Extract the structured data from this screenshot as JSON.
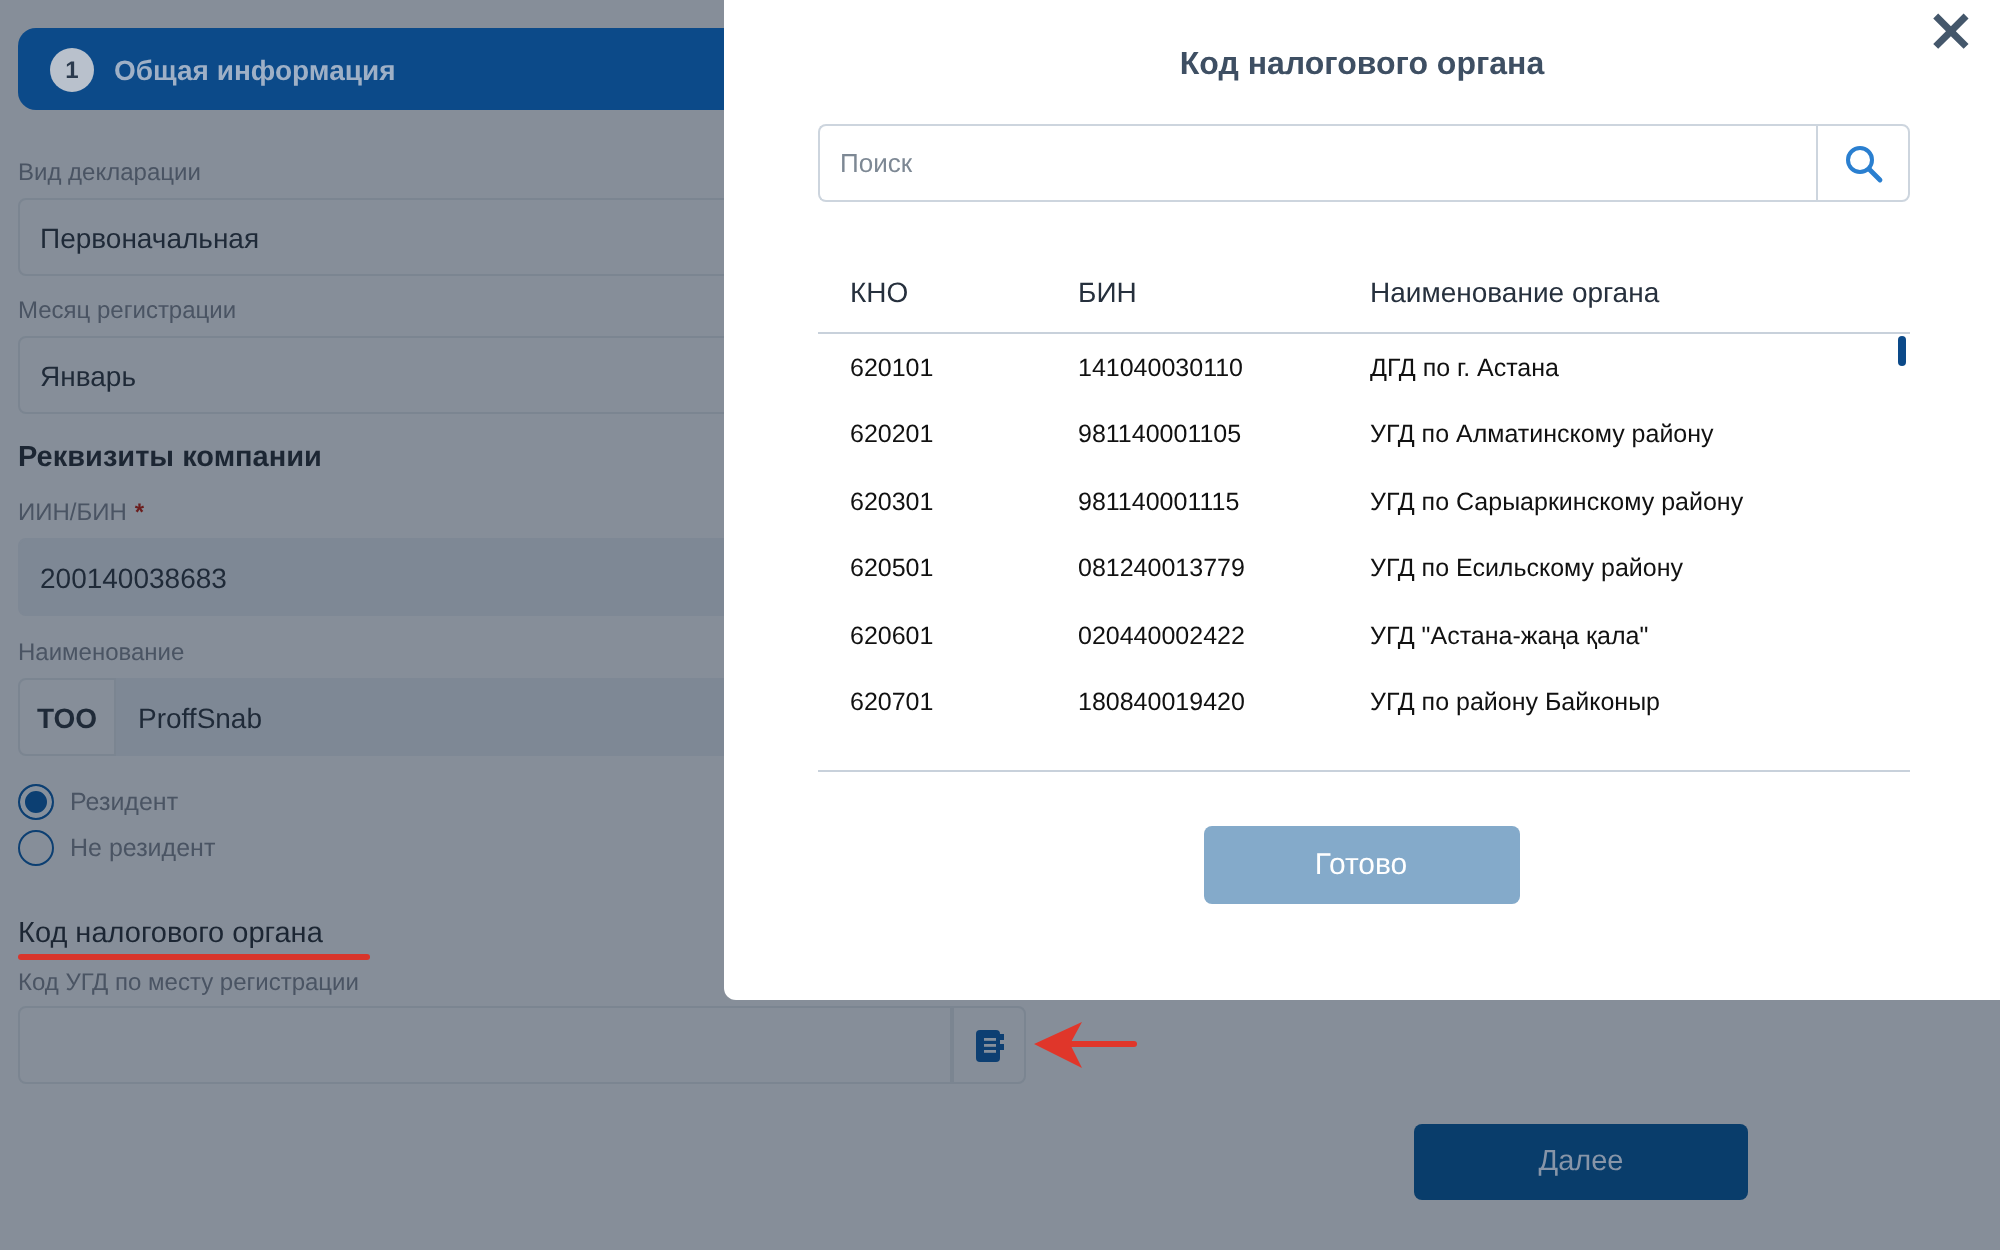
{
  "step": {
    "number": "1",
    "label": "Общая информация"
  },
  "form": {
    "declaration_type": {
      "label": "Вид декларации",
      "value": "Первоначальная"
    },
    "registration_month": {
      "label": "Месяц регистрации",
      "value": "Январь"
    },
    "section_title": "Реквизиты компании",
    "iin_bin": {
      "label": "ИИН/БИН",
      "required_mark": "*",
      "value": "200140038683"
    },
    "name": {
      "label": "Наименование",
      "prefix": "ТОО",
      "value": "ProffSnab"
    },
    "residency": [
      {
        "label": "Резидент",
        "selected": true
      },
      {
        "label": "Не резидент",
        "selected": false
      }
    ],
    "tax_office_heading": "Код налогового органа",
    "ugd_code": {
      "label": "Код УГД по месту регистрации"
    }
  },
  "next_button": "Далее",
  "modal": {
    "title": "Код налогового органа",
    "close": "×",
    "search": {
      "placeholder": "Поиск"
    },
    "columns": [
      "КНО",
      "БИН",
      "Наименование органа"
    ],
    "rows": [
      [
        "620101",
        "141040030110",
        "ДГД по г. Астана"
      ],
      [
        "620201",
        "981140001105",
        "УГД по Алматинскому району"
      ],
      [
        "620301",
        "981140001115",
        "УГД по Сарыаркинскому району"
      ],
      [
        "620501",
        "081240013779",
        "УГД по Есильскому району"
      ],
      [
        "620601",
        "020440002422",
        "УГД \"Астана-жаңа қала\""
      ],
      [
        "620701",
        "180840019420",
        "УГД по району Байконыр"
      ]
    ],
    "done_button": "Готово"
  }
}
